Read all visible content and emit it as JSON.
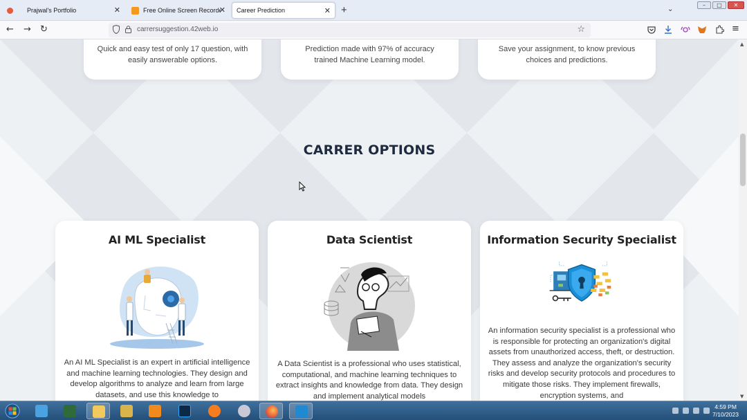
{
  "browser": {
    "tabs": [
      {
        "title": "Prajwal's Portfolio",
        "active": false
      },
      {
        "title": "Free Online Screen Recorder &",
        "active": false
      },
      {
        "title": "Career Prediction",
        "active": true
      }
    ],
    "url": "carrersuggestion.42web.io"
  },
  "features": [
    {
      "text": "Quick and easy test of only 17 question, with easily answerable options."
    },
    {
      "text": "Prediction made with 97% of accuracy trained Machine Learning model."
    },
    {
      "text": "Save your assignment, to know previous choices and predictions."
    }
  ],
  "section": {
    "heading": "CARRER OPTIONS"
  },
  "careers": [
    {
      "title": "AI ML Specialist",
      "icon": "ai-robot-illustration",
      "description": "An AI ML Specialist is an expert in artificial intelligence and machine learning technologies. They design and develop algorithms to analyze and learn from large datasets, and use this knowledge to"
    },
    {
      "title": "Data Scientist",
      "icon": "data-scientist-illustration",
      "description": "A Data Scientist is a professional who uses statistical, computational, and machine learning techniques to extract insights and knowledge from data. They design and implement analytical models"
    },
    {
      "title": "Information Security Specialist",
      "icon": "security-shield-illustration",
      "description": "An information security specialist is a professional who is responsible for protecting an organization's digital assets from unauthorized access, theft, or destruction. They assess and analyze the organization's security risks and develop security protocols and procedures to mitigate those risks. They implement firewalls, encryption systems, and"
    }
  ],
  "taskbar": {
    "time": "4:59 PM",
    "date": "7/10/2023"
  },
  "colors": {
    "heading": "#1e2a3e",
    "background": "#eef1f4",
    "taskbar": "#2f5f8c"
  }
}
